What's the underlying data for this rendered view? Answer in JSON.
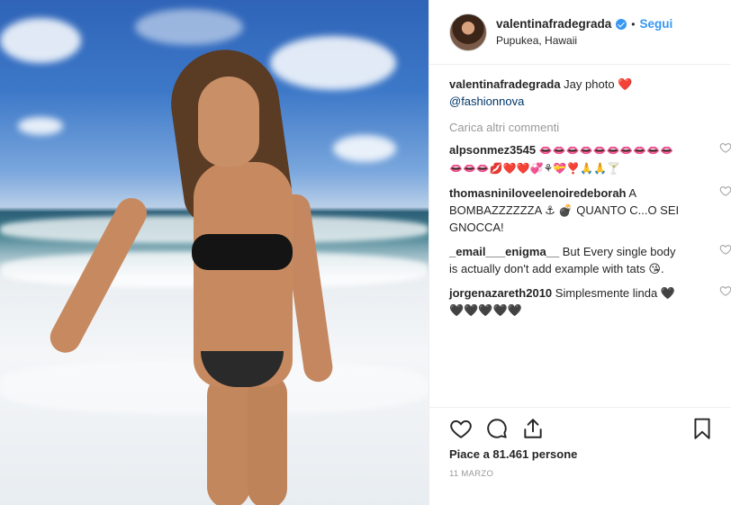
{
  "post": {
    "username": "valentinafradegrada",
    "follow_label": "Segui",
    "dot": "•",
    "location": "Pupukea, Hawaii"
  },
  "caption": {
    "username": "valentinafradegrada",
    "text": "Jay photo",
    "emoji": "❤️",
    "mention": "@fashionnova"
  },
  "load_more_label": "Carica altri commenti",
  "comments": [
    {
      "username": "alpsonmez3545",
      "text": "👄👄👄👄👄👄👄👄👄👄👄👄👄💋❤️❤️💞⚘💝❣️🙏🙏🍸"
    },
    {
      "username": "thomasniniloveelenoiredeborah",
      "text": "A BOMBAZZZZZZA ⚓ 💣 QUANTO C...O SEI GNOCCA!"
    },
    {
      "username": "_email___enigma__",
      "text": "But Every single body is actually don't add example with tats 😘."
    },
    {
      "username": "jorgenazareth2010",
      "text": "Simplesmente linda 🖤🖤🖤🖤🖤🖤"
    }
  ],
  "likes_text": "Piace a 81.461 persone",
  "date": "11 MARZO",
  "icons": {
    "like": "heart-outline-icon",
    "comment": "speech-bubble-icon",
    "share": "share-upload-icon",
    "save": "bookmark-icon",
    "verified": "verified-badge-icon"
  }
}
